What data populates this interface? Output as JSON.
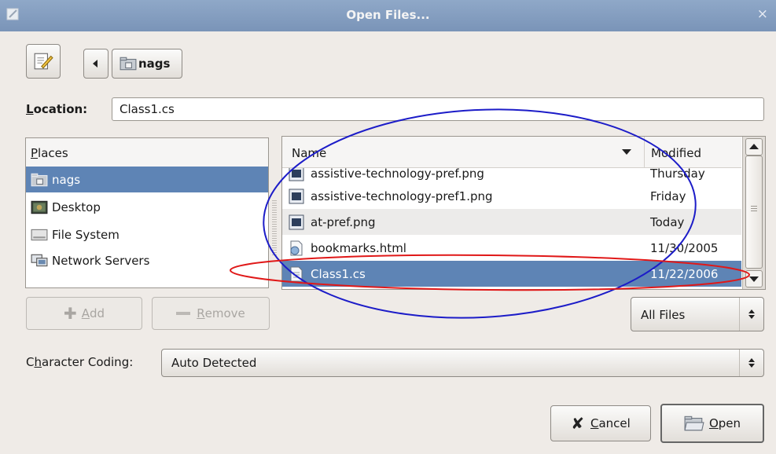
{
  "window": {
    "title": "Open Files...",
    "close_glyph": "×"
  },
  "toolbar": {
    "path_current": "nags"
  },
  "location": {
    "label_first": "L",
    "label_rest": "ocation:",
    "value": "Class1.cs"
  },
  "places": {
    "header_first": "P",
    "header_rest": "laces",
    "items": [
      {
        "label": "nags",
        "icon": "home-folder-icon",
        "selected": true
      },
      {
        "label": "Desktop",
        "icon": "desktop-icon",
        "selected": false
      },
      {
        "label": "File System",
        "icon": "drive-icon",
        "selected": false
      },
      {
        "label": "Network Servers",
        "icon": "network-icon",
        "selected": false
      }
    ]
  },
  "files": {
    "col_name": "Name",
    "col_modified": "Modified",
    "rows": [
      {
        "name": "assistive-technology-pref.png",
        "modified": "Thursday",
        "icon": "image-file-icon"
      },
      {
        "name": "assistive-technology-pref1.png",
        "modified": "Friday",
        "icon": "image-file-icon"
      },
      {
        "name": "at-pref.png",
        "modified": "Today",
        "icon": "image-file-icon"
      },
      {
        "name": "bookmarks.html",
        "modified": "11/30/2005",
        "icon": "html-file-icon"
      },
      {
        "name": "Class1.cs",
        "modified": "11/22/2006",
        "icon": "text-file-icon",
        "selected": true
      }
    ]
  },
  "buttons": {
    "add_first": "A",
    "add_rest": "dd",
    "remove_first": "R",
    "remove_rest": "emove",
    "cancel_first": "C",
    "cancel_rest": "ancel",
    "open_first": "O",
    "open_rest": "pen"
  },
  "filter": {
    "value": "All Files"
  },
  "coding": {
    "label_a": "C",
    "label_b": "h",
    "label_c": "aracter Coding:",
    "value": "Auto Detected"
  },
  "colors": {
    "selection": "#5e84b5",
    "title_bar": "#8fa8c8",
    "annotation_blue": "#1c1cc8",
    "annotation_red": "#e01818"
  }
}
